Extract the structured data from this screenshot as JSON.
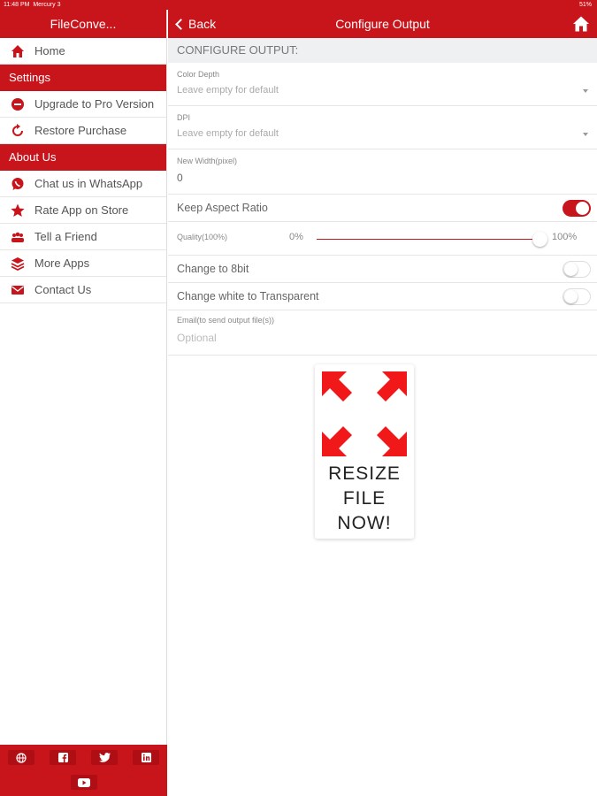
{
  "status": {
    "time": "11:48 PM",
    "carrier": "Mercury 3",
    "battery": "51%"
  },
  "sidebar": {
    "title": "FileConve...",
    "items_top": [
      {
        "label": "Home",
        "icon": "home-icon"
      }
    ],
    "settings_header": "Settings",
    "settings_items": [
      {
        "label": "Upgrade to Pro Version",
        "icon": "minus-circle-icon"
      },
      {
        "label": "Restore Purchase",
        "icon": "refresh-icon"
      }
    ],
    "about_header": "About Us",
    "about_items": [
      {
        "label": "Chat us in WhatsApp",
        "icon": "whatsapp-icon"
      },
      {
        "label": "Rate App on Store",
        "icon": "star-icon"
      },
      {
        "label": "Tell a Friend",
        "icon": "users-icon"
      },
      {
        "label": "More Apps",
        "icon": "layers-icon"
      },
      {
        "label": "Contact Us",
        "icon": "mail-icon"
      }
    ],
    "social": [
      "globe-icon",
      "facebook-icon",
      "twitter-icon",
      "linkedin-icon",
      "youtube-icon"
    ]
  },
  "topbar": {
    "back_label": "Back",
    "title": "Configure Output"
  },
  "form": {
    "section_title": "CONFIGURE OUTPUT:",
    "color_depth": {
      "label": "Color Depth",
      "placeholder": "Leave empty for default"
    },
    "dpi": {
      "label": "DPI",
      "placeholder": "Leave empty for default"
    },
    "new_width": {
      "label": "New Width(pixel)",
      "value": "0"
    },
    "keep_aspect": {
      "label": "Keep Aspect Ratio",
      "on": true
    },
    "quality": {
      "label": "Quality(100%)",
      "min": "0%",
      "max": "100%",
      "value": 1.0
    },
    "to_8bit": {
      "label": "Change to 8bit",
      "on": false
    },
    "transparent": {
      "label": "Change white to Transparent",
      "on": false
    },
    "email": {
      "label": "Email(to send output file(s))",
      "placeholder": "Optional"
    }
  },
  "resize_button": {
    "line1": "RESIZE",
    "line2": "FILE",
    "line3": "NOW!"
  },
  "colors": {
    "brand_red": "#c8141b"
  }
}
